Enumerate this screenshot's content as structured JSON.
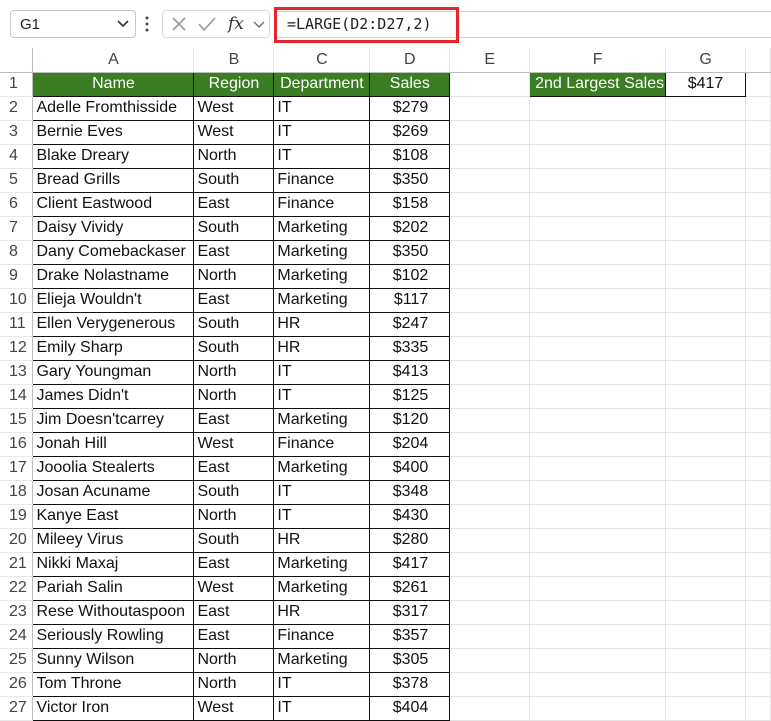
{
  "name_box": {
    "value": "G1"
  },
  "formula_bar": {
    "formula": "=LARGE(D2:D27,2)",
    "icons": [
      "cancel-icon",
      "enter-icon",
      "fx-icon",
      "chevron-down-icon"
    ]
  },
  "columns": [
    "A",
    "B",
    "C",
    "D",
    "E",
    "F",
    "G"
  ],
  "header_row": {
    "row": "1",
    "name": "Name",
    "region": "Region",
    "department": "Department",
    "sales": "Sales"
  },
  "result": {
    "label": "2nd Largest Sales",
    "value": "$417"
  },
  "rows": [
    {
      "row": "2",
      "name": "Adelle Fromthisside",
      "region": "West",
      "department": "IT",
      "sales": "$279"
    },
    {
      "row": "3",
      "name": "Bernie Eves",
      "region": "West",
      "department": "IT",
      "sales": "$269"
    },
    {
      "row": "4",
      "name": "Blake Dreary",
      "region": "North",
      "department": "IT",
      "sales": "$108"
    },
    {
      "row": "5",
      "name": "Bread Grills",
      "region": "South",
      "department": "Finance",
      "sales": "$350"
    },
    {
      "row": "6",
      "name": "Client Eastwood",
      "region": "East",
      "department": "Finance",
      "sales": "$158"
    },
    {
      "row": "7",
      "name": "Daisy Vividy",
      "region": "South",
      "department": "Marketing",
      "sales": "$202"
    },
    {
      "row": "8",
      "name": "Dany Comebackaser",
      "region": "East",
      "department": "Marketing",
      "sales": "$350"
    },
    {
      "row": "9",
      "name": "Drake Nolastname",
      "region": "North",
      "department": "Marketing",
      "sales": "$102"
    },
    {
      "row": "10",
      "name": "Elieja Wouldn't",
      "region": "East",
      "department": "Marketing",
      "sales": "$117"
    },
    {
      "row": "11",
      "name": "Ellen Verygenerous",
      "region": "South",
      "department": "HR",
      "sales": "$247"
    },
    {
      "row": "12",
      "name": "Emily Sharp",
      "region": "South",
      "department": "HR",
      "sales": "$335"
    },
    {
      "row": "13",
      "name": "Gary Youngman",
      "region": "North",
      "department": "IT",
      "sales": "$413"
    },
    {
      "row": "14",
      "name": "James Didn't",
      "region": "North",
      "department": "IT",
      "sales": "$125"
    },
    {
      "row": "15",
      "name": "Jim Doesn'tcarrey",
      "region": "East",
      "department": "Marketing",
      "sales": "$120"
    },
    {
      "row": "16",
      "name": "Jonah Hill",
      "region": "West",
      "department": "Finance",
      "sales": "$204"
    },
    {
      "row": "17",
      "name": "Jooolia Stealerts",
      "region": "East",
      "department": "Marketing",
      "sales": "$400"
    },
    {
      "row": "18",
      "name": "Josan Acuname",
      "region": "South",
      "department": "IT",
      "sales": "$348"
    },
    {
      "row": "19",
      "name": "Kanye East",
      "region": "North",
      "department": "IT",
      "sales": "$430"
    },
    {
      "row": "20",
      "name": "Mileey Virus",
      "region": "South",
      "department": "HR",
      "sales": "$280"
    },
    {
      "row": "21",
      "name": "Nikki Maxaj",
      "region": "East",
      "department": "Marketing",
      "sales": "$417"
    },
    {
      "row": "22",
      "name": "Pariah Salin",
      "region": "West",
      "department": "Marketing",
      "sales": "$261"
    },
    {
      "row": "23",
      "name": "Rese Withoutaspoon",
      "region": "East",
      "department": "HR",
      "sales": "$317"
    },
    {
      "row": "24",
      "name": "Seriously Rowling",
      "region": "East",
      "department": "Finance",
      "sales": "$357"
    },
    {
      "row": "25",
      "name": "Sunny Wilson",
      "region": "North",
      "department": "Marketing",
      "sales": "$305"
    },
    {
      "row": "26",
      "name": "Tom Throne",
      "region": "North",
      "department": "IT",
      "sales": "$378"
    },
    {
      "row": "27",
      "name": "Victor Iron",
      "region": "West",
      "department": "IT",
      "sales": "$404"
    }
  ],
  "colors": {
    "header_fill": "#3b7d23",
    "highlight": "#e3262b"
  }
}
